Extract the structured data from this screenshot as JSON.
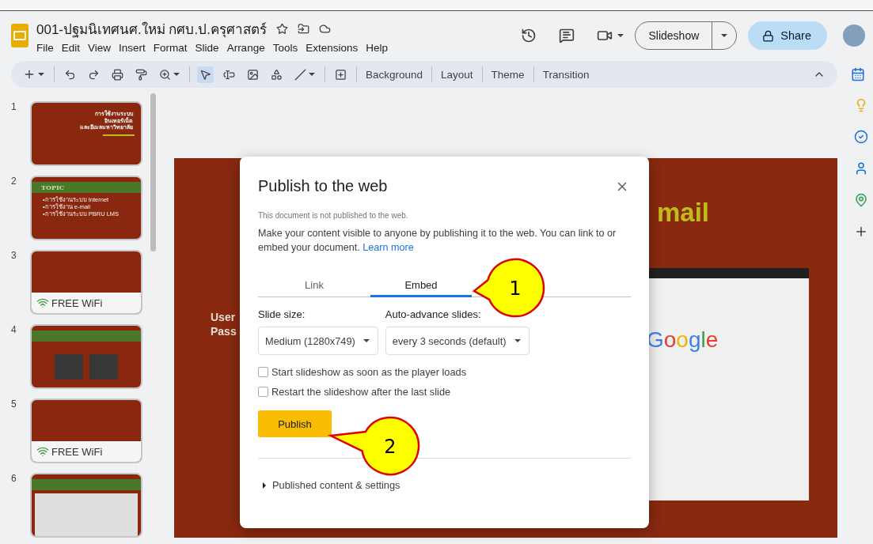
{
  "document": {
    "title": "001-ปฐมนิเทศนศ.ใหม่ กศบ.ป.ครุศาสตร์"
  },
  "menu": [
    "File",
    "Edit",
    "View",
    "Insert",
    "Format",
    "Slide",
    "Arrange",
    "Tools",
    "Extensions",
    "Help"
  ],
  "header": {
    "slideshow": "Slideshow",
    "share": "Share"
  },
  "toolbar": {
    "buttons": [
      "Background",
      "Layout",
      "Theme",
      "Transition"
    ]
  },
  "slides": [
    {
      "number": "1",
      "kind": "title",
      "texts": [
        "การใช้งานระบบ",
        "อินเทอร์เน็ต",
        "และอีเมลมหาวิทยาลัย"
      ]
    },
    {
      "number": "2",
      "kind": "topic",
      "texts": [
        "TOPIC",
        "•การใช้งานระบบ Internet",
        "•การใช้งาน e-mail",
        "•การใช้งานระบบ PBRU LMS"
      ]
    },
    {
      "number": "3",
      "kind": "wifi",
      "texts": [
        "FREE WiFi"
      ]
    },
    {
      "number": "4",
      "kind": "photos"
    },
    {
      "number": "5",
      "kind": "wifi",
      "texts": [
        "FREE WiFi"
      ]
    },
    {
      "number": "6",
      "kind": "table"
    }
  ],
  "canvas": {
    "heading": "mail",
    "labels": [
      "User",
      "Pass"
    ],
    "logo": "Google"
  },
  "dialog": {
    "title": "Publish to the web",
    "status": "This document is not published to the web.",
    "description": "Make your content visible to anyone by publishing it to the web. You can link to or embed your document.",
    "link": "Learn more",
    "tabs": [
      {
        "label": "Link",
        "selected": false
      },
      {
        "label": "Embed",
        "selected": true
      }
    ],
    "fields": [
      {
        "label": "Slide size:",
        "value": "Medium (1280x749)"
      },
      {
        "label": "Auto-advance slides:",
        "value": "every 3 seconds (default)"
      }
    ],
    "options": [
      {
        "label": "Start slideshow as soon as the player loads",
        "checked": false
      },
      {
        "label": "Restart the slideshow after the last slide",
        "checked": false
      }
    ],
    "publish_button": "Publish",
    "expander": {
      "label": "Published content & settings",
      "expanded": false
    }
  },
  "callouts": [
    {
      "label": "1"
    },
    {
      "label": "2"
    }
  ]
}
